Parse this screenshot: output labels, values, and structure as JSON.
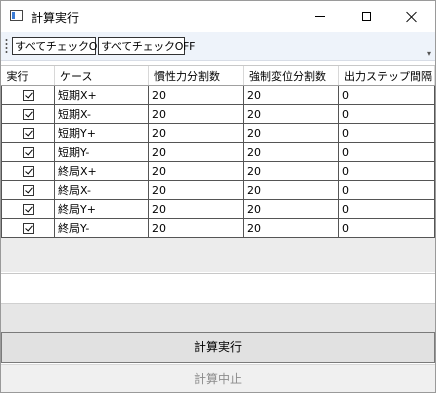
{
  "window": {
    "title": "計算実行",
    "icon": "app-window-icon"
  },
  "toolbar": {
    "check_all_on": "すべてチェックON",
    "check_all_off": "すべてチェックOFF"
  },
  "grid": {
    "headers": [
      "実行",
      "ケース",
      "慣性力分割数",
      "強制変位分割数",
      "出力ステップ間隔"
    ],
    "rows": [
      {
        "checked": true,
        "case": "短期X+",
        "inertia": "20",
        "forced": "20",
        "step": "0"
      },
      {
        "checked": true,
        "case": "短期X-",
        "inertia": "20",
        "forced": "20",
        "step": "0"
      },
      {
        "checked": true,
        "case": "短期Y+",
        "inertia": "20",
        "forced": "20",
        "step": "0"
      },
      {
        "checked": true,
        "case": "短期Y-",
        "inertia": "20",
        "forced": "20",
        "step": "0"
      },
      {
        "checked": true,
        "case": "終局X+",
        "inertia": "20",
        "forced": "20",
        "step": "0"
      },
      {
        "checked": true,
        "case": "終局X-",
        "inertia": "20",
        "forced": "20",
        "step": "0"
      },
      {
        "checked": true,
        "case": "終局Y+",
        "inertia": "20",
        "forced": "20",
        "step": "0"
      },
      {
        "checked": true,
        "case": "終局Y-",
        "inertia": "20",
        "forced": "20",
        "step": "0"
      }
    ]
  },
  "actions": {
    "run_label": "計算実行",
    "stop_label": "計算中止"
  }
}
